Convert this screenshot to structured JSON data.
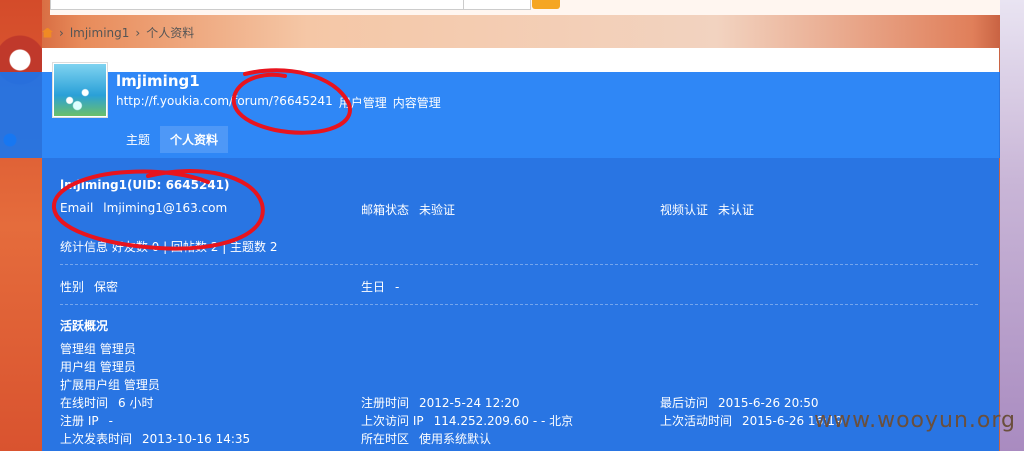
{
  "breadcrumb": {
    "user": "lmjiming1",
    "section": "个人资料",
    "sep": "›"
  },
  "header": {
    "username": "lmjiming1",
    "url": "http://f.youkia.com/forum/?6645241",
    "links": [
      "用户管理",
      "内容管理"
    ]
  },
  "tabs": [
    {
      "label": "主题"
    },
    {
      "label": "个人资料"
    }
  ],
  "profile": {
    "title": "lmjiming1(UID: 6645241)",
    "email_label": "Email",
    "email": "lmjiming1@163.com",
    "mail_status_label": "邮箱状态",
    "mail_status": "未验证",
    "video_label": "视频认证",
    "video": "未认证",
    "stats": "统计信息 好友数 0 | 回帖数 2 | 主题数 2",
    "gender_label": "性别",
    "gender": "保密",
    "birthday_label": "生日",
    "birthday": "-",
    "activity_title": "活跃概况",
    "admin_group_label": "管理组",
    "admin_group": "管理员",
    "user_group_label": "用户组",
    "user_group": "管理员",
    "ext_group_label": "扩展用户组",
    "ext_group": "管理员",
    "online_label": "在线时间",
    "online": "6 小时",
    "reg_time_label": "注册时间",
    "reg_time": "2012-5-24 12:20",
    "last_visit_label": "最后访问",
    "last_visit": "2015-6-26 20:50",
    "reg_ip_label": "注册 IP",
    "reg_ip": "-",
    "last_ip_label": "上次访问 IP",
    "last_ip": "114.252.209.60 - - 北京",
    "last_active_label": "上次活动时间",
    "last_active": "2015-6-26 16:19",
    "last_post_label": "上次发表时间",
    "last_post": "2013-10-16 14:35",
    "tz_label": "所在时区",
    "tz": "使用系统默认"
  },
  "watermark": "www.wooyun.org",
  "colors": {
    "overlay": "#1276f5",
    "scribble": "#e8141e",
    "accent": "#f5a623"
  }
}
